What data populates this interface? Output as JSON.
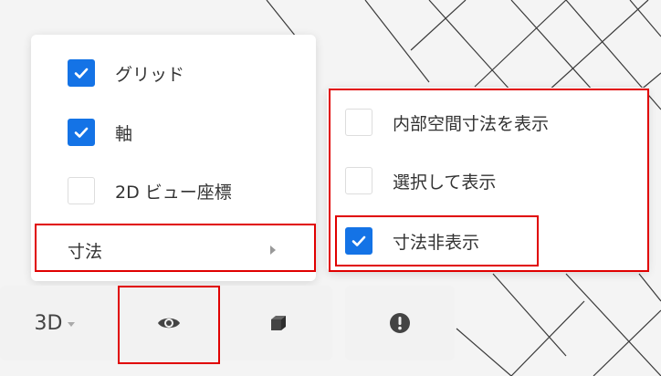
{
  "view_menu": {
    "items": [
      {
        "label": "グリッド",
        "checked": true
      },
      {
        "label": "軸",
        "checked": true
      },
      {
        "label": "2D ビュー座標",
        "checked": false
      }
    ],
    "dimensions_label": "寸法"
  },
  "dimensions_submenu": {
    "items": [
      {
        "label": "内部空間寸法を表示",
        "checked": false
      },
      {
        "label": "選択して表示",
        "checked": false
      },
      {
        "label": "寸法非表示",
        "checked": true
      }
    ]
  },
  "toolbar": {
    "view_mode_label": "3D",
    "icons": [
      "eye-icon",
      "cube-icon",
      "alert-icon"
    ]
  },
  "colors": {
    "accent": "#1473e6",
    "highlight": "#e00000"
  }
}
